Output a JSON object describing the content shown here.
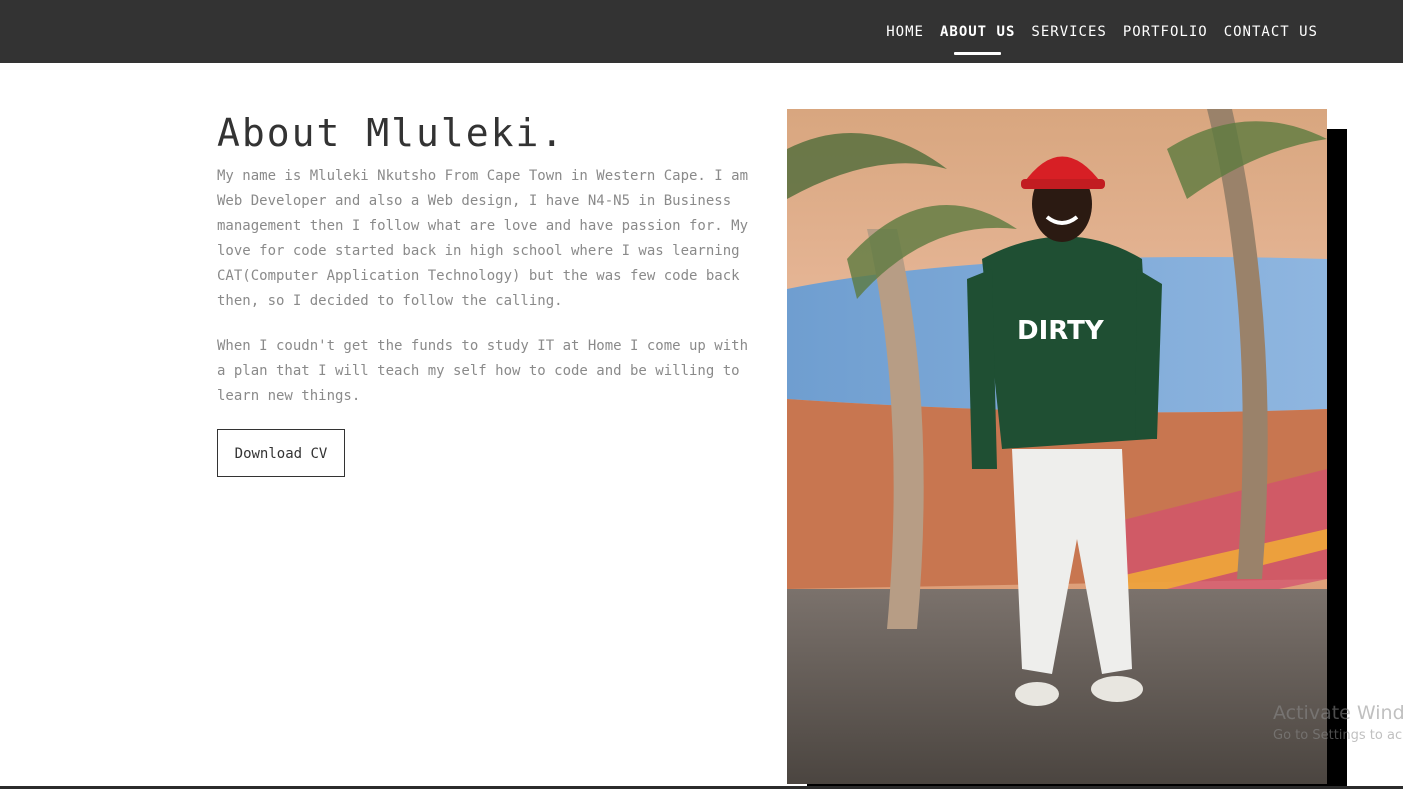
{
  "nav": {
    "items": [
      {
        "label": "HOME"
      },
      {
        "label": "ABOUT US"
      },
      {
        "label": "SERVICES"
      },
      {
        "label": "PORTFOLIO"
      },
      {
        "label": "CONTACT US"
      }
    ],
    "active": "ABOUT US"
  },
  "about": {
    "heading": "About Mluleki.",
    "paragraph1": "My name is Mluleki Nkutsho From Cape Town in Western Cape. I am Web Developer and also a Web design, I have N4-N5 in Business management then I follow what are love and have passion for. My love for code started back in high school where I was learning CAT(Computer Application Technology) but the was few code back then, so I decided to follow the calling.",
    "paragraph2": "When I coudn't get the funds to study IT at Home I come up with a plan that I will teach my self how to code and be willing to learn new things.",
    "download_label": "Download CV"
  },
  "photo": {
    "hoodie_text": "DIRTY"
  },
  "watermark": {
    "line1": "Activate Windo",
    "line2": "Go to Settings to ac"
  },
  "colors": {
    "navbar": "#333333",
    "text_dark": "#333333",
    "text_muted": "#8a8a8a"
  }
}
